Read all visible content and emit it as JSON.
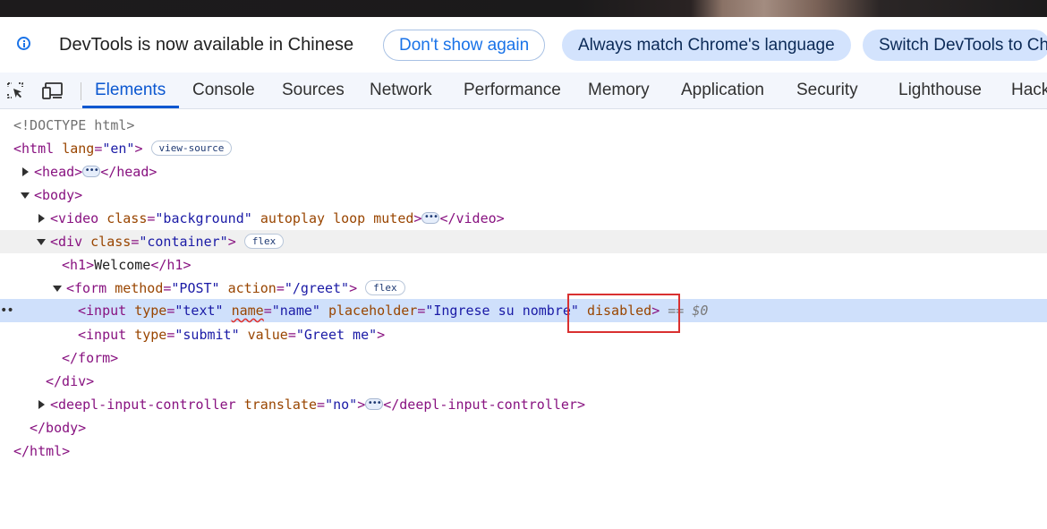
{
  "infobar": {
    "message": "DevTools is now available in Chinese",
    "dont_show_again": "Don't show again",
    "always_match": "Always match Chrome's language",
    "switch_devtools": "Switch DevTools to Ch"
  },
  "tabs": [
    "Elements",
    "Console",
    "Sources",
    "Network",
    "Performance",
    "Memory",
    "Application",
    "Security",
    "Lighthouse",
    "Hack"
  ],
  "active_tab": "Elements",
  "dom": {
    "doctype": "<!DOCTYPE html>",
    "html_open": "<html",
    "html_lang_attr": "lang",
    "html_lang_val": "\"en\"",
    "html_close_bracket": ">",
    "view_source_badge": "view-source",
    "head_open": "<head>",
    "head_close": "</head>",
    "body_open": "<body>",
    "video_open": "<video",
    "video_class_attr": "class",
    "video_class_val": "\"background\"",
    "video_flags": "autoplay loop muted",
    "video_bracket": ">",
    "video_close": "</video>",
    "div_open": "<div",
    "div_class_attr": "class",
    "div_class_val": "\"container\"",
    "div_bracket": ">",
    "flex_badge": "flex",
    "h1_open": "<h1>",
    "h1_text": "Welcome",
    "h1_close": "</h1>",
    "form_open": "<form",
    "form_method_attr": "method",
    "form_method_val": "\"POST\"",
    "form_action_attr": "action",
    "form_action_val": "\"/greet\"",
    "form_bracket": ">",
    "input1_open": "<input",
    "input1_type_attr": "type",
    "input1_type_val": "\"text\"",
    "input1_name_attr": "name",
    "input1_name_val": "\"name\"",
    "input1_placeholder_attr": "placeholder",
    "input1_placeholder_val": "\"Ingrese su nombre\"",
    "input1_disabled_attr": "disabled",
    "input1_bracket": ">",
    "selected_marker": "== $0",
    "input2_open": "<input",
    "input2_type_attr": "type",
    "input2_type_val": "\"submit\"",
    "input2_value_attr": "value",
    "input2_value_val": "\"Greet me\"",
    "input2_bracket": ">",
    "form_close": "</form>",
    "div_close": "</div>",
    "deepl_open": "<deepl-input-controller",
    "deepl_translate_attr": "translate",
    "deepl_translate_val": "\"no\"",
    "deepl_bracket": ">",
    "deepl_close": "</deepl-input-controller>",
    "body_close": "</body>",
    "html_close": "</html>",
    "gutter_dots": "••"
  },
  "colors": {
    "accent": "#0b57d0",
    "highlight_box": "#d93030",
    "selected_row": "#cfe0fb"
  }
}
